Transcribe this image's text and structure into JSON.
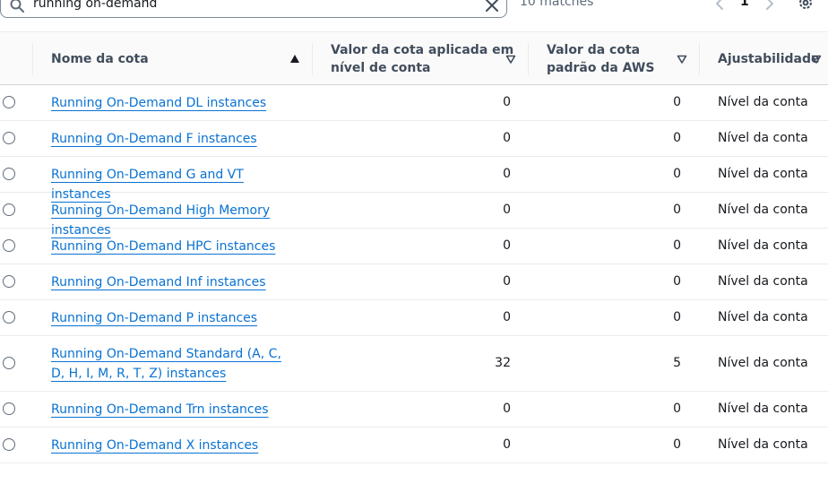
{
  "search": {
    "value": "running on-demand",
    "matches": "10 matches",
    "page": "1"
  },
  "icons": {
    "search": "search-icon",
    "clear": "close-icon",
    "prev": "chevron-left-icon",
    "next": "chevron-right-icon",
    "settings": "gear-icon",
    "sort_asc": "caret-up-filled-icon",
    "sort_none": "caret-down-outline-icon"
  },
  "columns": {
    "name": "Nome da cota",
    "applied": "Valor da cota aplicada em nível de conta",
    "applied_line1": "Valor da cota aplicada em",
    "applied_line2": "nível de conta",
    "default": "Valor da cota padrão da AWS",
    "default_line1": "Valor da cota",
    "default_line2": "padrão da AWS",
    "adjustability": "Ajustabilidade"
  },
  "rows": [
    {
      "name": "Running On-Demand DL instances",
      "applied": "0",
      "default": "0",
      "adjustability": "Nível da conta"
    },
    {
      "name": "Running On-Demand F instances",
      "applied": "0",
      "default": "0",
      "adjustability": "Nível da conta"
    },
    {
      "name": "Running On-Demand G and VT instances",
      "applied": "0",
      "default": "0",
      "adjustability": "Nível da conta"
    },
    {
      "name": "Running On-Demand High Memory instances",
      "applied": "0",
      "default": "0",
      "adjustability": "Nível da conta"
    },
    {
      "name": "Running On-Demand HPC instances",
      "applied": "0",
      "default": "0",
      "adjustability": "Nível da conta"
    },
    {
      "name": "Running On-Demand Inf instances",
      "applied": "0",
      "default": "0",
      "adjustability": "Nível da conta"
    },
    {
      "name": "Running On-Demand P instances",
      "applied": "0",
      "default": "0",
      "adjustability": "Nível da conta"
    },
    {
      "name": "Running On-Demand Standard (A, C, D, H, I, M, R, T, Z) instances",
      "applied": "32",
      "default": "5",
      "adjustability": "Nível da conta"
    },
    {
      "name": "Running On-Demand Trn instances",
      "applied": "0",
      "default": "0",
      "adjustability": "Nível da conta"
    },
    {
      "name": "Running On-Demand X instances",
      "applied": "0",
      "default": "0",
      "adjustability": "Nível da conta"
    }
  ],
  "colors": {
    "link": "#0972d3",
    "header_text": "#414d5c",
    "border": "#e9ebed",
    "text": "#16191f"
  }
}
